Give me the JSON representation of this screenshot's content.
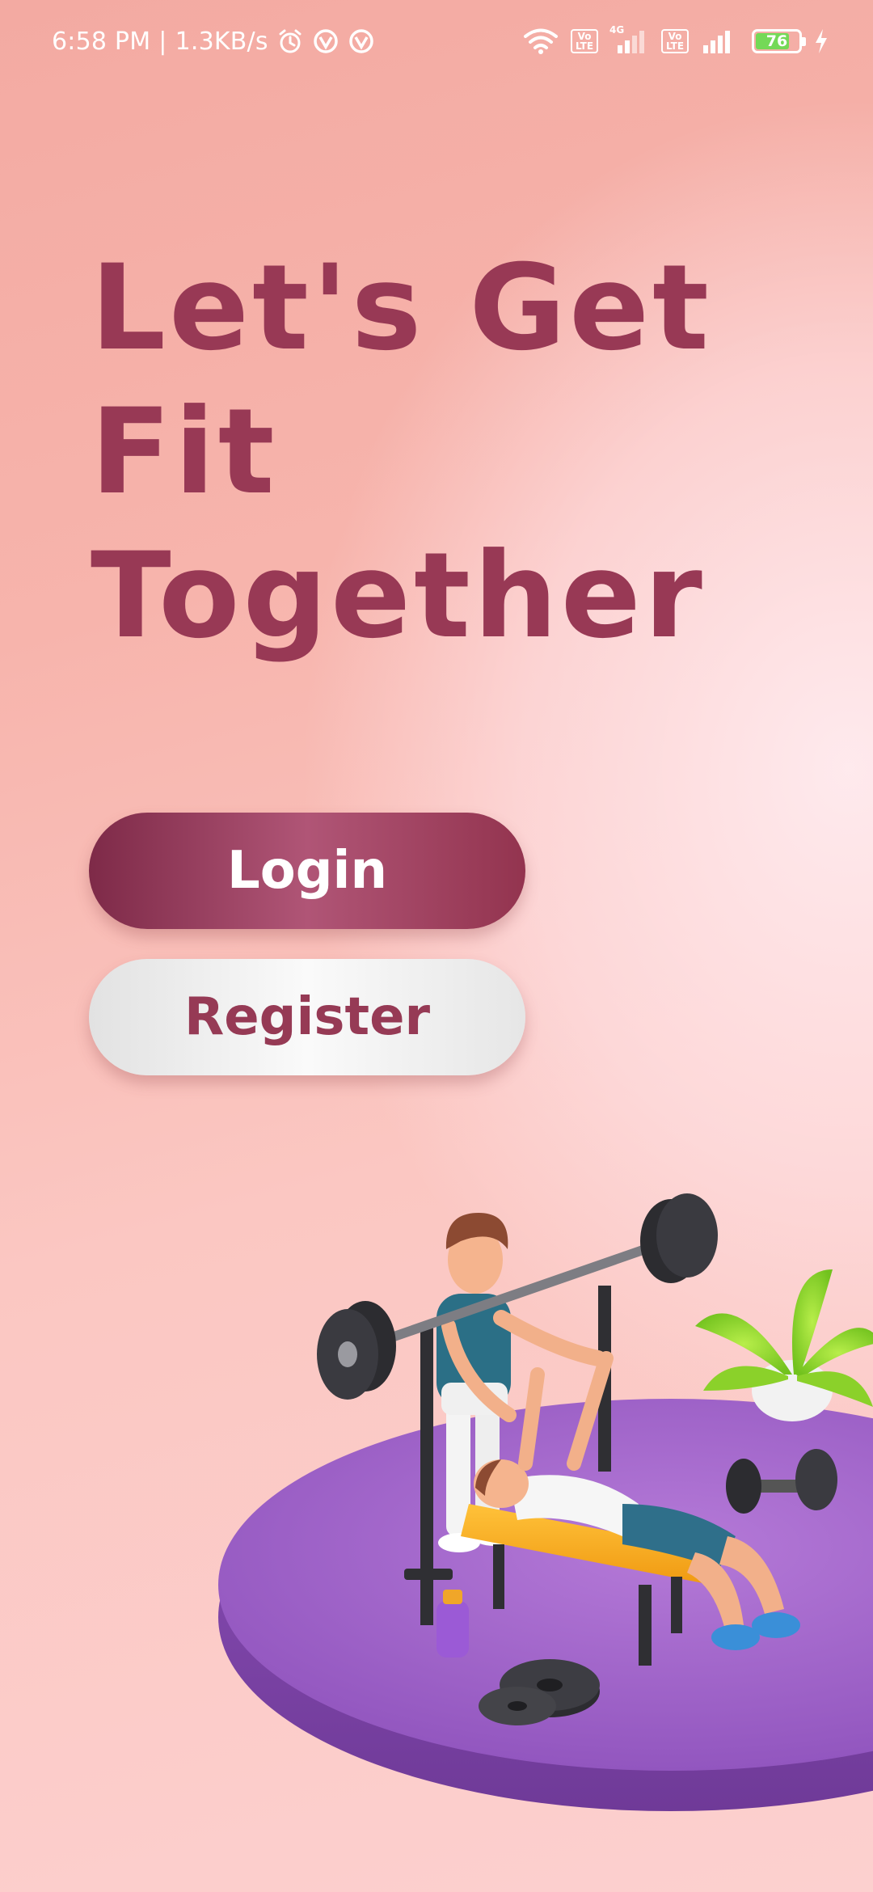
{
  "status_bar": {
    "time": "6:58 PM",
    "separator": "|",
    "speed": "1.3KB/s",
    "network": "4G",
    "volte_label": "Vo LTE",
    "battery_level": "76",
    "icons": [
      "alarm-icon",
      "vpn-icon",
      "vpn-icon",
      "wifi-icon",
      "volte-icon",
      "signal-icon",
      "volte-icon",
      "signal-icon",
      "battery-icon",
      "charging-icon"
    ]
  },
  "hero": {
    "line1": "Let's Get",
    "line2": "Fit",
    "line3": "Together"
  },
  "actions": {
    "login_label": "Login",
    "register_label": "Register"
  },
  "colors": {
    "headline": "#983955",
    "login_bg": "#983955",
    "register_text": "#963a55",
    "platform": "#9b5fc4",
    "bench": "#f4a623"
  },
  "illustration": {
    "subject": "3D-fitness-illustration",
    "icon": "bench-press-illustration"
  }
}
